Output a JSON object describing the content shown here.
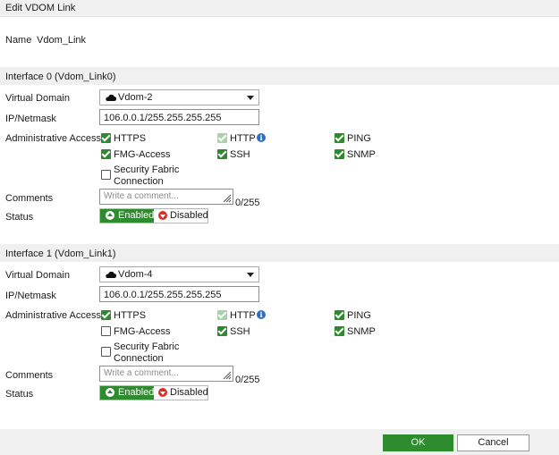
{
  "window": {
    "title": "Edit VDOM Link"
  },
  "name": {
    "label": "Name",
    "value": "Vdom_Link"
  },
  "labels": {
    "virtual_domain": "Virtual Domain",
    "ip_netmask": "IP/Netmask",
    "admin_access": "Administrative Access",
    "comments": "Comments",
    "status": "Status"
  },
  "interfaces": [
    {
      "header": "Interface 0 (Vdom_Link0)",
      "virtual_domain": "Vdom-2",
      "ip_netmask": "106.0.0.1/255.255.255.255",
      "access": {
        "https": {
          "label": "HTTPS",
          "checked": true
        },
        "http": {
          "label": "HTTP",
          "checked": true,
          "disabled": true
        },
        "ping": {
          "label": "PING",
          "checked": true
        },
        "fmg": {
          "label": "FMG-Access",
          "checked": true
        },
        "ssh": {
          "label": "SSH",
          "checked": true
        },
        "snmp": {
          "label": "SNMP",
          "checked": true
        },
        "fabric_line1": "Security Fabric",
        "fabric_line2": "Connection",
        "fabric_checked": false
      },
      "comments_placeholder": "Write a comment...",
      "comments_counter": "0/255",
      "status": {
        "enabled": "Enabled",
        "disabled": "Disabled",
        "selected": "Enabled"
      }
    },
    {
      "header": "Interface 1 (Vdom_Link1)",
      "virtual_domain": "Vdom-4",
      "ip_netmask": "106.0.0.1/255.255.255.255",
      "access": {
        "https": {
          "label": "HTTPS",
          "checked": true
        },
        "http": {
          "label": "HTTP",
          "checked": true,
          "disabled": true
        },
        "ping": {
          "label": "PING",
          "checked": true
        },
        "fmg": {
          "label": "FMG-Access",
          "checked": false
        },
        "ssh": {
          "label": "SSH",
          "checked": true
        },
        "snmp": {
          "label": "SNMP",
          "checked": true
        },
        "fabric_line1": "Security Fabric",
        "fabric_line2": "Connection",
        "fabric_checked": false
      },
      "comments_placeholder": "Write a comment...",
      "comments_counter": "0/255",
      "status": {
        "enabled": "Enabled",
        "disabled": "Disabled",
        "selected": "Enabled"
      }
    }
  ],
  "icons": {
    "virtual_domain": "cloud-icon",
    "http_info": "info-icon",
    "enabled": "arrow-up-circle-icon",
    "disabled": "arrow-down-circle-icon",
    "comment_resize": "resize-grip-icon",
    "select_caret": "chevron-down-icon"
  },
  "colors": {
    "accent": "#2e8b2e",
    "disabled_red": "#d93025",
    "info_blue": "#2d6fc4"
  },
  "footer": {
    "ok": "OK",
    "cancel": "Cancel"
  }
}
